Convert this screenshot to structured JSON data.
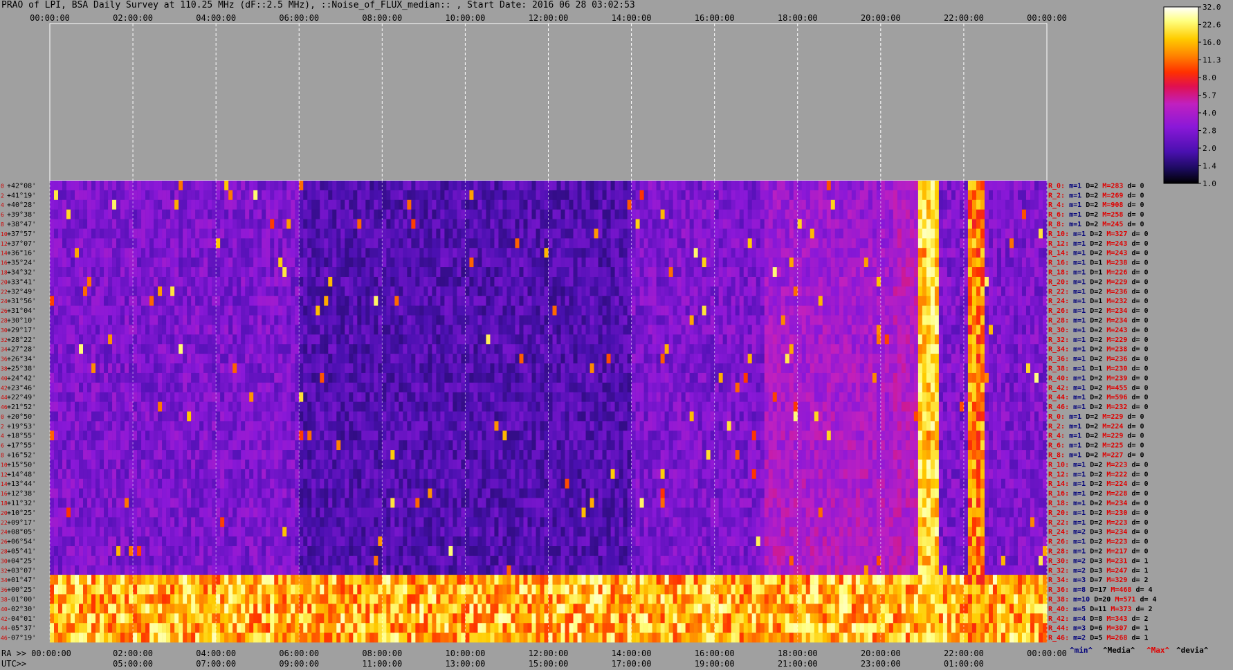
{
  "title": "PRAO of LPI, BSA Daily Survey at 110.25 MHz (dF::2.5 MHz), ::Noise_of_FLUX_median:: , Start Date: 2016 06 28 03:02:53",
  "colors": {
    "background": "#a0a0a0",
    "stat_min": "#00007a",
    "stat_median": "#000000",
    "stat_max": "#e00000",
    "stat_dev": "#000000",
    "row_label": "#d00000"
  },
  "chart_data": {
    "type": "heatmap",
    "title": "PRAO of LPI, BSA Daily Survey at 110.25 MHz (dF::2.5 MHz), ::Noise_of_FLUX_median:: , Start Date: 2016 06 28 03:02:53",
    "x_range_hours": [
      0,
      24
    ],
    "top_ticks": [
      "00:00:00",
      "02:00:00",
      "04:00:00",
      "06:00:00",
      "08:00:00",
      "10:00:00",
      "12:00:00",
      "14:00:00",
      "16:00:00",
      "18:00:00",
      "20:00:00",
      "22:00:00",
      "00:00:00"
    ],
    "ra_prefix": "RA >>",
    "ra_ticks": [
      "00:00:00",
      "02:00:00",
      "04:00:00",
      "06:00:00",
      "08:00:00",
      "10:00:00",
      "12:00:00",
      "14:00:00",
      "16:00:00",
      "18:00:00",
      "20:00:00",
      "22:00:00",
      "00:00:00"
    ],
    "utc_prefix": "UTC>>",
    "utc_ticks": [
      "05:00:00",
      "07:00:00",
      "09:00:00",
      "11:00:00",
      "13:00:00",
      "15:00:00",
      "17:00:00",
      "19:00:00",
      "21:00:00",
      "23:00:00",
      "01:00:00"
    ],
    "declinations": [
      "+42°08'",
      "+41°19'",
      "+40°28'",
      "+39°38'",
      "+38°47'",
      "+37°57'",
      "+37°07'",
      "+36°16'",
      "+35°24'",
      "+34°32'",
      "+33°41'",
      "+32°49'",
      "+31°56'",
      "+31°04'",
      "+30°10'",
      "+29°17'",
      "+28°22'",
      "+27°28'",
      "+26°34'",
      "+25°38'",
      "+24°42'",
      "+23°46'",
      "+22°49'",
      "+21°52'",
      "+20°50'",
      "+19°53'",
      "+18°55'",
      "+17°55'",
      "+16°52'",
      "+15°50'",
      "+14°48'",
      "+13°44'",
      "+12°38'",
      "+11°32'",
      "+10°25'",
      "+09°17'",
      "+08°05'",
      "+06°54'",
      "+05°41'",
      "+04°25'",
      "+03°07'",
      "+01°47'",
      "+00°25'",
      "-01°00'",
      "-02°30'",
      "-04°01'",
      "-05°37'",
      "-07°19'"
    ],
    "row_indices": [
      "0",
      "2",
      "4",
      "6",
      "8",
      "10",
      "12",
      "14",
      "16",
      "18",
      "20",
      "22",
      "24",
      "26",
      "28",
      "30",
      "32",
      "34",
      "36",
      "38",
      "40",
      "42",
      "44",
      "46",
      "0",
      "2",
      "4",
      "6",
      "8",
      "10",
      "12",
      "14",
      "16",
      "18",
      "20",
      "22",
      "24",
      "26",
      "28",
      "30",
      "32",
      "34",
      "36",
      "38",
      "40",
      "42",
      "44",
      "46"
    ],
    "rows": [
      {
        "label": "R_0:",
        "min": "m=1",
        "med": "D=2",
        "max": "M=283",
        "dev": "d= 0"
      },
      {
        "label": "R_2:",
        "min": "m=1",
        "med": "D=2",
        "max": "M=269",
        "dev": "d= 0"
      },
      {
        "label": "R_4:",
        "min": "m=1",
        "med": "D=2",
        "max": "M=908",
        "dev": "d= 0"
      },
      {
        "label": "R_6:",
        "min": "m=1",
        "med": "D=2",
        "max": "M=258",
        "dev": "d= 0"
      },
      {
        "label": "R_8:",
        "min": "m=1",
        "med": "D=2",
        "max": "M=245",
        "dev": "d= 0"
      },
      {
        "label": "R_10:",
        "min": "m=1",
        "med": "D=2",
        "max": "M=327",
        "dev": "d= 0"
      },
      {
        "label": "R_12:",
        "min": "m=1",
        "med": "D=2",
        "max": "M=243",
        "dev": "d= 0"
      },
      {
        "label": "R_14:",
        "min": "m=1",
        "med": "D=2",
        "max": "M=243",
        "dev": "d= 0"
      },
      {
        "label": "R_16:",
        "min": "m=1",
        "med": "D=1",
        "max": "M=238",
        "dev": "d= 0"
      },
      {
        "label": "R_18:",
        "min": "m=1",
        "med": "D=1",
        "max": "M=226",
        "dev": "d= 0"
      },
      {
        "label": "R_20:",
        "min": "m=1",
        "med": "D=2",
        "max": "M=229",
        "dev": "d= 0"
      },
      {
        "label": "R_22:",
        "min": "m=1",
        "med": "D=2",
        "max": "M=236",
        "dev": "d= 0"
      },
      {
        "label": "R_24:",
        "min": "m=1",
        "med": "D=1",
        "max": "M=232",
        "dev": "d= 0"
      },
      {
        "label": "R_26:",
        "min": "m=1",
        "med": "D=2",
        "max": "M=234",
        "dev": "d= 0"
      },
      {
        "label": "R_28:",
        "min": "m=1",
        "med": "D=2",
        "max": "M=234",
        "dev": "d= 0"
      },
      {
        "label": "R_30:",
        "min": "m=1",
        "med": "D=2",
        "max": "M=243",
        "dev": "d= 0"
      },
      {
        "label": "R_32:",
        "min": "m=1",
        "med": "D=2",
        "max": "M=229",
        "dev": "d= 0"
      },
      {
        "label": "R_34:",
        "min": "m=1",
        "med": "D=2",
        "max": "M=238",
        "dev": "d= 0"
      },
      {
        "label": "R_36:",
        "min": "m=1",
        "med": "D=2",
        "max": "M=236",
        "dev": "d= 0"
      },
      {
        "label": "R_38:",
        "min": "m=1",
        "med": "D=1",
        "max": "M=230",
        "dev": "d= 0"
      },
      {
        "label": "R_40:",
        "min": "m=1",
        "med": "D=2",
        "max": "M=239",
        "dev": "d= 0"
      },
      {
        "label": "R_42:",
        "min": "m=1",
        "med": "D=2",
        "max": "M=455",
        "dev": "d= 0"
      },
      {
        "label": "R_44:",
        "min": "m=1",
        "med": "D=2",
        "max": "M=596",
        "dev": "d= 0"
      },
      {
        "label": "R_46:",
        "min": "m=1",
        "med": "D=2",
        "max": "M=232",
        "dev": "d= 0"
      },
      {
        "label": "R_0:",
        "min": "m=1",
        "med": "D=2",
        "max": "M=229",
        "dev": "d= 0"
      },
      {
        "label": "R_2:",
        "min": "m=1",
        "med": "D=2",
        "max": "M=224",
        "dev": "d= 0"
      },
      {
        "label": "R_4:",
        "min": "m=1",
        "med": "D=2",
        "max": "M=229",
        "dev": "d= 0"
      },
      {
        "label": "R_6:",
        "min": "m=1",
        "med": "D=2",
        "max": "M=225",
        "dev": "d= 0"
      },
      {
        "label": "R_8:",
        "min": "m=1",
        "med": "D=2",
        "max": "M=227",
        "dev": "d= 0"
      },
      {
        "label": "R_10:",
        "min": "m=1",
        "med": "D=2",
        "max": "M=223",
        "dev": "d= 0"
      },
      {
        "label": "R_12:",
        "min": "m=1",
        "med": "D=2",
        "max": "M=222",
        "dev": "d= 0"
      },
      {
        "label": "R_14:",
        "min": "m=1",
        "med": "D=2",
        "max": "M=224",
        "dev": "d= 0"
      },
      {
        "label": "R_16:",
        "min": "m=1",
        "med": "D=2",
        "max": "M=228",
        "dev": "d= 0"
      },
      {
        "label": "R_18:",
        "min": "m=1",
        "med": "D=2",
        "max": "M=234",
        "dev": "d= 0"
      },
      {
        "label": "R_20:",
        "min": "m=1",
        "med": "D=2",
        "max": "M=230",
        "dev": "d= 0"
      },
      {
        "label": "R_22:",
        "min": "m=1",
        "med": "D=2",
        "max": "M=223",
        "dev": "d= 0"
      },
      {
        "label": "R_24:",
        "min": "m=2",
        "med": "D=3",
        "max": "M=234",
        "dev": "d= 0"
      },
      {
        "label": "R_26:",
        "min": "m=1",
        "med": "D=2",
        "max": "M=223",
        "dev": "d= 0"
      },
      {
        "label": "R_28:",
        "min": "m=1",
        "med": "D=2",
        "max": "M=217",
        "dev": "d= 0"
      },
      {
        "label": "R_30:",
        "min": "m=2",
        "med": "D=3",
        "max": "M=231",
        "dev": "d= 1"
      },
      {
        "label": "R_32:",
        "min": "m=2",
        "med": "D=3",
        "max": "M=247",
        "dev": "d= 1"
      },
      {
        "label": "R_34:",
        "min": "m=3",
        "med": "D=7",
        "max": "M=329",
        "dev": "d= 2"
      },
      {
        "label": "R_36:",
        "min": "m=8",
        "med": "D=17",
        "max": "M=468",
        "dev": "d= 4"
      },
      {
        "label": "R_38:",
        "min": "m=10",
        "med": "D=20",
        "max": "M=571",
        "dev": "d= 4"
      },
      {
        "label": "R_40:",
        "min": "m=5",
        "med": "D=11",
        "max": "M=373",
        "dev": "d= 2"
      },
      {
        "label": "R_42:",
        "min": "m=4",
        "med": "D=8",
        "max": "M=343",
        "dev": "d= 2"
      },
      {
        "label": "R_44:",
        "min": "m=3",
        "med": "D=6",
        "max": "M=307",
        "dev": "d= 1"
      },
      {
        "label": "R_46:",
        "min": "m=2",
        "med": "D=5",
        "max": "M=268",
        "dev": "d= 1"
      }
    ],
    "footer_labels": {
      "min": "^min^",
      "median": "^Media^",
      "max": "^Max^",
      "dev": "^devia^"
    },
    "colorbar": {
      "range": [
        1.0,
        32.0
      ],
      "ticks": [
        "32.0",
        "22.6",
        "16.0",
        "11.3",
        "8.0",
        "5.7",
        "4.0",
        "2.8",
        "2.0",
        "1.4",
        "1.0"
      ],
      "stops": [
        "#000000",
        "#1a0a5a",
        "#4a10b0",
        "#8a18d8",
        "#c020c0",
        "#e01050",
        "#ff3000",
        "#ff8000",
        "#ffcc00",
        "#ffff80",
        "#ffffff"
      ]
    }
  }
}
